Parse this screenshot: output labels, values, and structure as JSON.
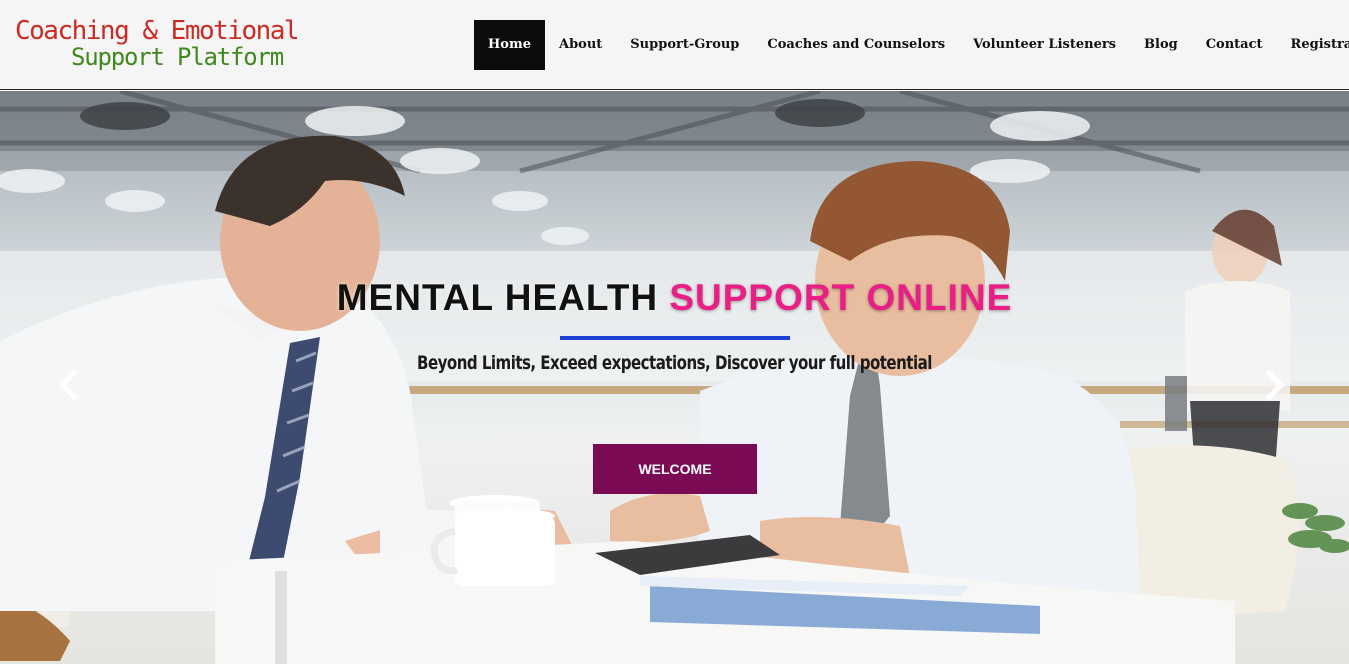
{
  "brand": {
    "line1": "Coaching & Emotional",
    "line2": "Support Platform"
  },
  "nav": {
    "items": [
      {
        "label": "Home",
        "active": true
      },
      {
        "label": "About"
      },
      {
        "label": "Support-Group"
      },
      {
        "label": "Coaches and Counselors"
      },
      {
        "label": "Volunteer Listeners"
      },
      {
        "label": "Blog"
      },
      {
        "label": "Contact"
      },
      {
        "label": "Registration",
        "dropdown": true
      }
    ]
  },
  "hero": {
    "headline_part1": "MENTAL HEALTH",
    "headline_part2": "SUPPORT ONLINE",
    "subheadline": "Beyond Limits, Exceed expectations, Discover your full potential",
    "cta_label": "WELCOME",
    "prev_icon": "chevron-left-icon",
    "next_icon": "chevron-right-icon"
  },
  "colors": {
    "brand_red": "#cc2a24",
    "brand_green": "#3f8a1e",
    "nav_active_bg": "#0c0c0c",
    "headline_accent": "#ea1f86",
    "divider": "#1c3fd6",
    "cta_bg": "#7b0a55"
  }
}
